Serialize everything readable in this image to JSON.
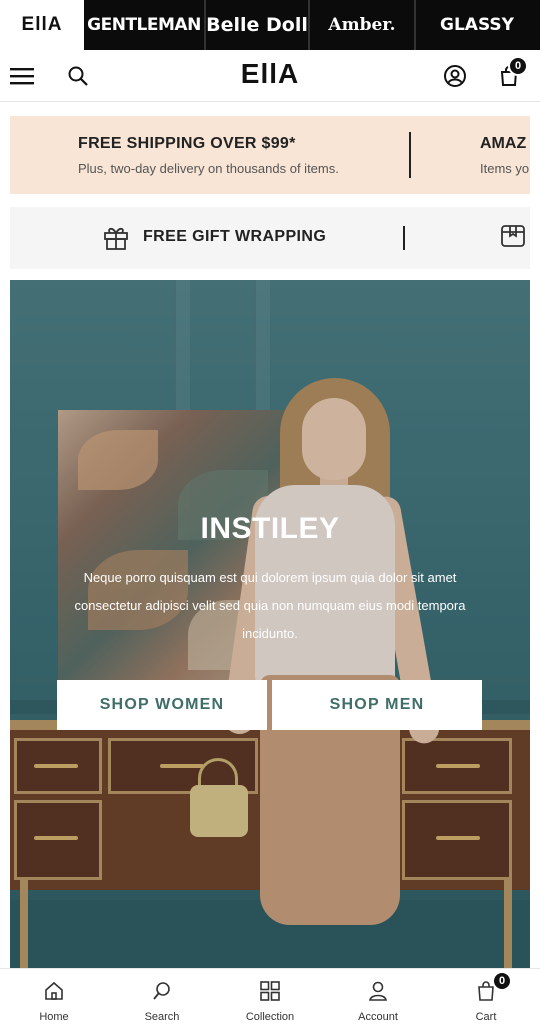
{
  "brand_bar": {
    "tabs": [
      {
        "label": "EllA",
        "active": true
      },
      {
        "label": "GENTLEMAN",
        "active": false
      },
      {
        "label": "Belle Doll",
        "active": false
      },
      {
        "label": "Amber.",
        "active": false
      },
      {
        "label": "GLASSY",
        "active": false
      }
    ]
  },
  "header": {
    "logo": "EllA",
    "icons": [
      "menu-icon",
      "search-icon",
      "account-icon",
      "cart-icon"
    ],
    "cart_count": "0"
  },
  "promos": {
    "shipping_title": "FREE SHIPPING OVER $99*",
    "shipping_sub": "Plus, two-day delivery on thousands of items.",
    "next_title": "AMAZ",
    "next_sub": "Items yo",
    "gift_text": "FREE GIFT WRAPPING"
  },
  "hero": {
    "title": "INSTILEY",
    "description": "Neque porro quisquam est qui dolorem ipsum quia dolor sit amet consectetur adipisci velit sed quia non numquam eius modi tempora incidunto.",
    "button_women": "SHOP WOMEN",
    "button_men": "SHOP MEN"
  },
  "bottom_nav": {
    "items": [
      {
        "label": "Home",
        "icon": "home-icon"
      },
      {
        "label": "Search",
        "icon": "search-icon"
      },
      {
        "label": "Collection",
        "icon": "grid-icon"
      },
      {
        "label": "Account",
        "icon": "user-icon"
      },
      {
        "label": "Cart",
        "icon": "cart-icon"
      }
    ],
    "cart_count": "0"
  },
  "colors": {
    "brand_bar_bg": "#0b0b0b",
    "promo_peach": "#f8e5d6",
    "promo_gray": "#f5f5f5",
    "button_text": "#3f6d68",
    "hero_wall": "#3e6f76"
  }
}
